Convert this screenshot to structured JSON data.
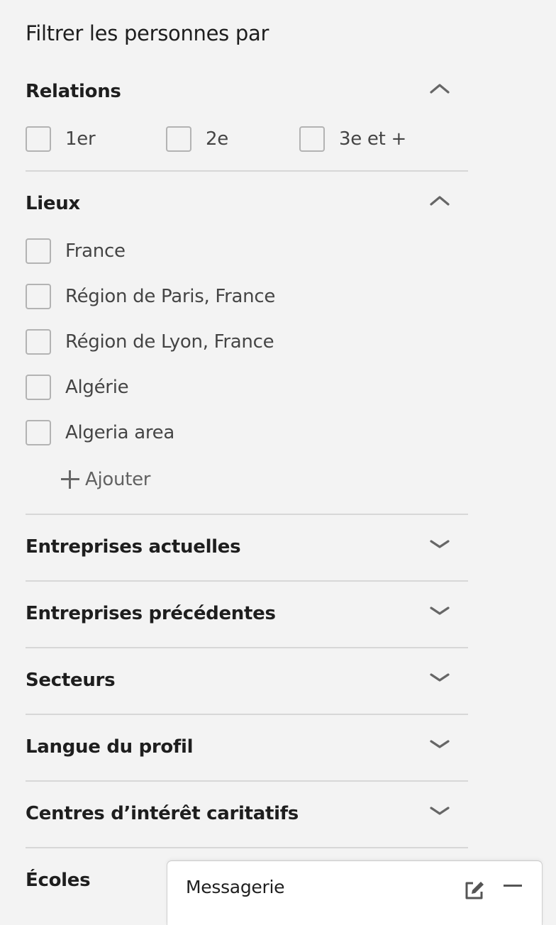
{
  "filter_panel": {
    "title": "Filtrer les personnes par",
    "relations": {
      "title": "Relations",
      "chevron": "chevron-up-icon",
      "options": [
        {
          "label": "1er",
          "checked": false
        },
        {
          "label": "2e",
          "checked": false
        },
        {
          "label": "3e et +",
          "checked": false
        }
      ]
    },
    "lieux": {
      "title": "Lieux",
      "chevron": "chevron-up-icon",
      "options": [
        {
          "label": "France",
          "checked": false
        },
        {
          "label": "Région de Paris, France",
          "checked": false
        },
        {
          "label": "Région de Lyon, France",
          "checked": false
        },
        {
          "label": "Algérie",
          "checked": false
        },
        {
          "label": "Algeria area",
          "checked": false
        }
      ],
      "add_label": "Ajouter",
      "add_icon": "plus-icon"
    },
    "collapsed_sections": [
      {
        "title": "Entreprises actuelles",
        "chevron": "chevron-down-icon"
      },
      {
        "title": "Entreprises précédentes",
        "chevron": "chevron-down-icon"
      },
      {
        "title": "Secteurs",
        "chevron": "chevron-down-icon"
      },
      {
        "title": "Langue du profil",
        "chevron": "chevron-down-icon"
      },
      {
        "title": "Centres d’intérêt caritatifs",
        "chevron": "chevron-down-icon"
      },
      {
        "title": "Écoles"
      }
    ]
  },
  "messaging": {
    "title": "Messagerie",
    "compose_icon": "compose-icon",
    "minimize_icon": "minimize-icon"
  },
  "colors": {
    "background": "#f3f3f3",
    "divider": "#d7d7d7",
    "checkbox_border": "#b3b3b3",
    "icon": "#666666"
  }
}
